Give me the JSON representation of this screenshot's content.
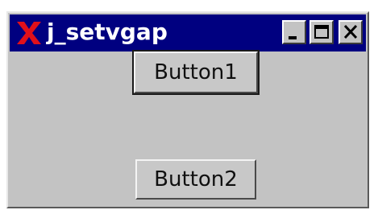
{
  "window": {
    "title": "j_setvgap",
    "controls": {
      "minimize": "minimize-icon",
      "maximize": "maximize-icon",
      "close": "close-icon"
    }
  },
  "content": {
    "button1_label": "Button1",
    "button2_label": "Button2"
  },
  "colors": {
    "titlebar": "#000080",
    "window_bg": "#c3c3c3",
    "icon_red": "#e0101a"
  }
}
